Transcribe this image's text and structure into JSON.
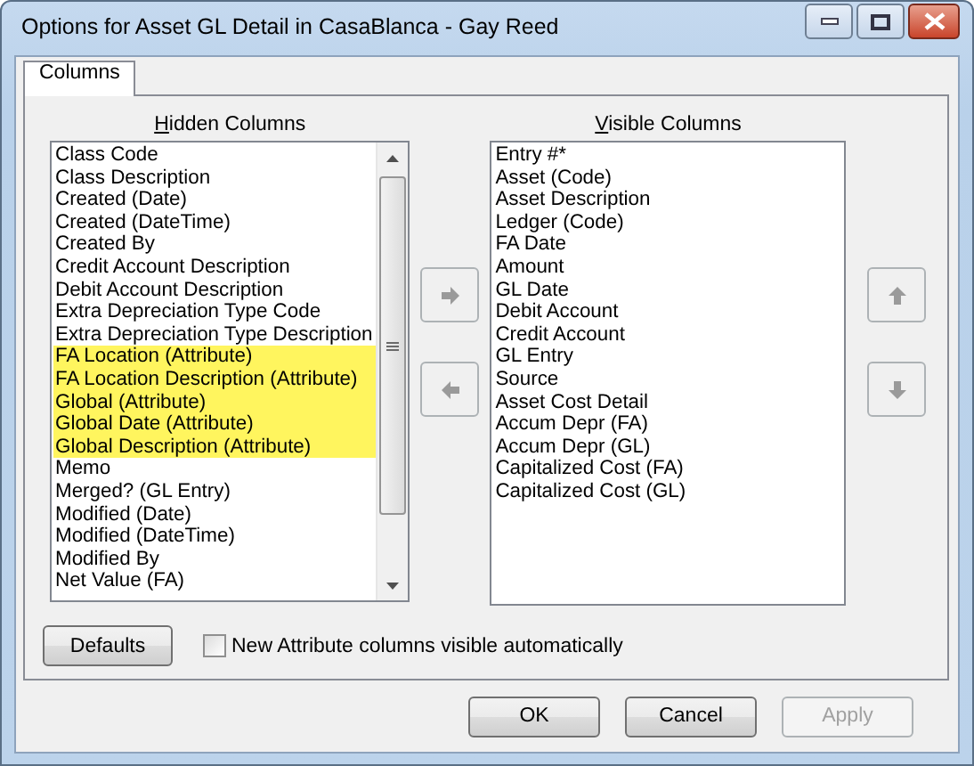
{
  "window": {
    "title": "Options for Asset GL Detail in CasaBlanca - Gay Reed"
  },
  "tabs": [
    {
      "label": "Columns",
      "selected": true
    }
  ],
  "hidden_columns": {
    "label": "Hidden Columns",
    "items": [
      {
        "text": "Class Code",
        "selected": false
      },
      {
        "text": "Class Description",
        "selected": false
      },
      {
        "text": "Created (Date)",
        "selected": false
      },
      {
        "text": "Created (DateTime)",
        "selected": false
      },
      {
        "text": "Created By",
        "selected": false
      },
      {
        "text": "Credit Account Description",
        "selected": false
      },
      {
        "text": "Debit Account Description",
        "selected": false
      },
      {
        "text": "Extra Depreciation Type Code",
        "selected": false
      },
      {
        "text": "Extra Depreciation Type Description",
        "selected": false
      },
      {
        "text": "FA Location (Attribute)",
        "selected": true
      },
      {
        "text": "FA Location Description (Attribute)",
        "selected": true
      },
      {
        "text": "Global (Attribute)",
        "selected": true
      },
      {
        "text": "Global Date (Attribute)",
        "selected": true
      },
      {
        "text": "Global Description (Attribute)",
        "selected": true
      },
      {
        "text": "Memo",
        "selected": false
      },
      {
        "text": "Merged? (GL Entry)",
        "selected": false
      },
      {
        "text": "Modified (Date)",
        "selected": false
      },
      {
        "text": "Modified (DateTime)",
        "selected": false
      },
      {
        "text": "Modified By",
        "selected": false
      },
      {
        "text": "Net Value (FA)",
        "selected": false
      }
    ]
  },
  "visible_columns": {
    "label": "Visible Columns",
    "items": [
      {
        "text": "Entry #*",
        "selected": false
      },
      {
        "text": "Asset (Code)",
        "selected": false
      },
      {
        "text": "Asset Description",
        "selected": false
      },
      {
        "text": "Ledger (Code)",
        "selected": false
      },
      {
        "text": "FA Date",
        "selected": false
      },
      {
        "text": "Amount",
        "selected": false
      },
      {
        "text": "GL Date",
        "selected": false
      },
      {
        "text": "Debit Account",
        "selected": false
      },
      {
        "text": "Credit Account",
        "selected": false
      },
      {
        "text": "GL Entry",
        "selected": false
      },
      {
        "text": "Source",
        "selected": false
      },
      {
        "text": "Asset Cost Detail",
        "selected": false
      },
      {
        "text": "Accum Depr (FA)",
        "selected": false
      },
      {
        "text": "Accum Depr (GL)",
        "selected": false
      },
      {
        "text": "Capitalized Cost (FA)",
        "selected": false
      },
      {
        "text": "Capitalized Cost (GL)",
        "selected": false
      }
    ]
  },
  "defaults_button": {
    "label": "Defaults"
  },
  "auto_visible_checkbox": {
    "label": "New Attribute columns visible automatically",
    "checked": false
  },
  "buttons": [
    {
      "label": "OK",
      "disabled": false
    },
    {
      "label": "Cancel",
      "disabled": false
    },
    {
      "label": "Apply",
      "disabled": true
    }
  ]
}
